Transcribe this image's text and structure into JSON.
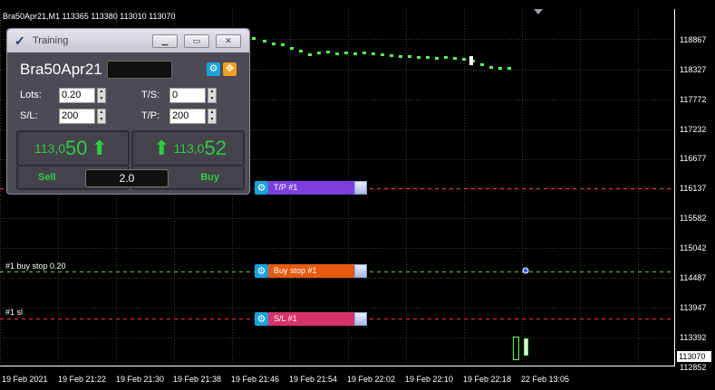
{
  "chart": {
    "symbol_header": "Bra50Apr21,M1  113365 113380 113010 113070",
    "price_axis": [
      "118867",
      "118327",
      "117772",
      "117232",
      "116677",
      "116137",
      "115582",
      "115042",
      "114487",
      "113947",
      "113392",
      "112852"
    ],
    "current_price": "113070",
    "time_axis": [
      "19 Feb 2021",
      "19 Feb 21:22",
      "19 Feb 21:30",
      "19 Feb 21:38",
      "19 Feb 21:46",
      "19 Feb 21:54",
      "19 Feb 22:02",
      "19 Feb 22:10",
      "19 Feb 22:18",
      "22 Feb 13:05"
    ],
    "colors": {
      "background": "#000000",
      "grid": "#3a3a3a",
      "price_line": "#55ff55",
      "tp_line": "#ff3030",
      "buy_stop_line": "#66cc33",
      "sl_line": "#ff3030"
    }
  },
  "lines": {
    "buy_stop_label": "#1 buy stop 0.20",
    "sl_label": "#1 sl"
  },
  "orders": {
    "tp": {
      "label": "T/P #1",
      "color": "#7b3fe0",
      "icon": "gear-icon"
    },
    "buy_stop": {
      "label": "Buy stop #1",
      "color": "#e65a12",
      "icon": "gear-icon"
    },
    "sl": {
      "label": "S/L #1",
      "color": "#d6336c",
      "icon": "gear-icon"
    }
  },
  "panel": {
    "title": "Training",
    "symbol": "Bra50Apr21",
    "lots_label": "Lots:",
    "lots_value": "0.20",
    "sl_label": "S/L:",
    "sl_value": "200",
    "ts_label": "T/S:",
    "ts_value": "0",
    "tp_label": "T/P:",
    "tp_value": "200",
    "sell_price_small": "113,0",
    "sell_price_big": "50",
    "buy_price_small": "113,0",
    "buy_price_big": "52",
    "sell_label": "Sell",
    "buy_label": "Buy",
    "volume": "2.0"
  }
}
